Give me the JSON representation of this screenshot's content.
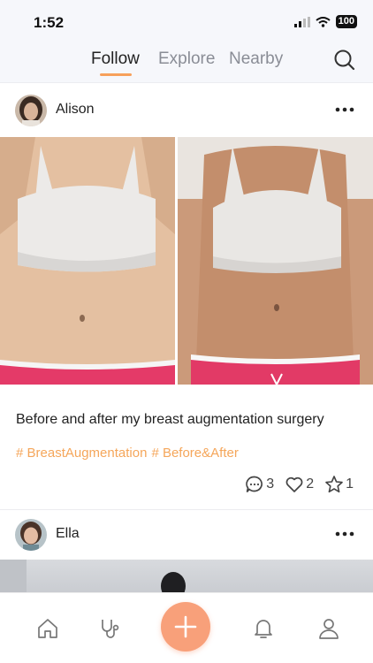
{
  "status_bar": {
    "time": "1:52",
    "battery": "100"
  },
  "top_nav": {
    "tabs": [
      {
        "label": "Follow",
        "active": true
      },
      {
        "label": "Explore",
        "active": false
      },
      {
        "label": "Nearby",
        "active": false
      }
    ],
    "search_icon": "search-icon",
    "accent_color": "#f7a05b"
  },
  "feed": {
    "posts": [
      {
        "author": "Alison",
        "caption": "Before and after my breast augmentation surgery",
        "hashtags": [
          "# BreastAugmentation",
          "# Before&After"
        ],
        "comments": "3",
        "likes": "2",
        "favorites": "1"
      },
      {
        "author": "Ella"
      }
    ]
  },
  "bottom_nav": {
    "items": [
      "home-icon",
      "stethoscope-icon",
      "plus-icon",
      "bell-icon",
      "profile-icon"
    ],
    "fab_color": "#f8a07a"
  }
}
